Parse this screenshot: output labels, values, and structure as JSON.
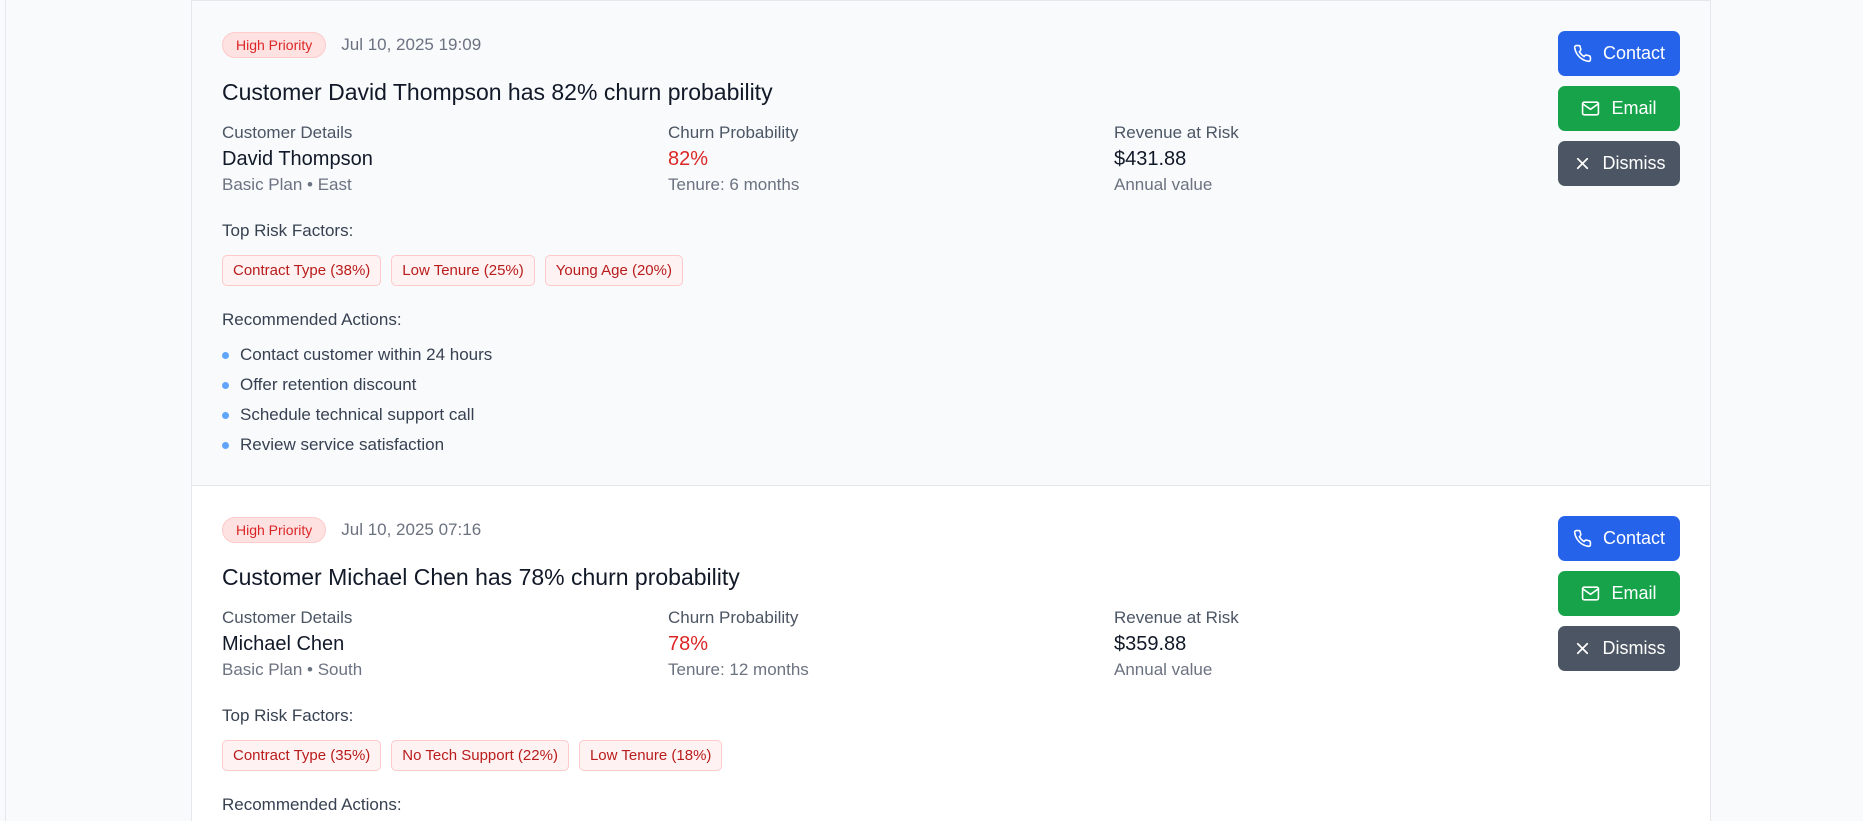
{
  "alerts": [
    {
      "priority": "High Priority",
      "timestamp": "Jul 10, 2025 19:09",
      "title": "Customer David Thompson has 82% churn probability",
      "customer_label": "Customer Details",
      "customer_name": "David Thompson",
      "customer_sub": "Basic Plan • East",
      "churn_label": "Churn Probability",
      "churn_value": "82%",
      "churn_sub": "Tenure: 6 months",
      "revenue_label": "Revenue at Risk",
      "revenue_value": "$431.88",
      "revenue_sub": "Annual value",
      "risk_label": "Top Risk Factors:",
      "risk_factors": [
        "Contract Type (38%)",
        "Low Tenure (25%)",
        "Young Age (20%)"
      ],
      "actions_label": "Recommended Actions:",
      "actions": [
        "Contact customer within 24 hours",
        "Offer retention discount",
        "Schedule technical support call",
        "Review service satisfaction"
      ],
      "buttons": {
        "contact": "Contact",
        "email": "Email",
        "dismiss": "Dismiss"
      }
    },
    {
      "priority": "High Priority",
      "timestamp": "Jul 10, 2025 07:16",
      "title": "Customer Michael Chen has 78% churn probability",
      "customer_label": "Customer Details",
      "customer_name": "Michael Chen",
      "customer_sub": "Basic Plan • South",
      "churn_label": "Churn Probability",
      "churn_value": "78%",
      "churn_sub": "Tenure: 12 months",
      "revenue_label": "Revenue at Risk",
      "revenue_value": "$359.88",
      "revenue_sub": "Annual value",
      "risk_label": "Top Risk Factors:",
      "risk_factors": [
        "Contract Type (35%)",
        "No Tech Support (22%)",
        "Low Tenure (18%)"
      ],
      "actions_label": "Recommended Actions:",
      "buttons": {
        "contact": "Contact",
        "email": "Email",
        "dismiss": "Dismiss"
      }
    }
  ],
  "colors": {
    "contact_button": "#2563eb",
    "email_button": "#16a34a",
    "dismiss_button": "#4b5563",
    "priority_badge": "#dc2626",
    "churn_value": "#dc2626"
  },
  "icons": {
    "contact": "phone-icon",
    "email": "mail-icon",
    "dismiss": "close-icon",
    "bullet": "bullet-dot"
  }
}
